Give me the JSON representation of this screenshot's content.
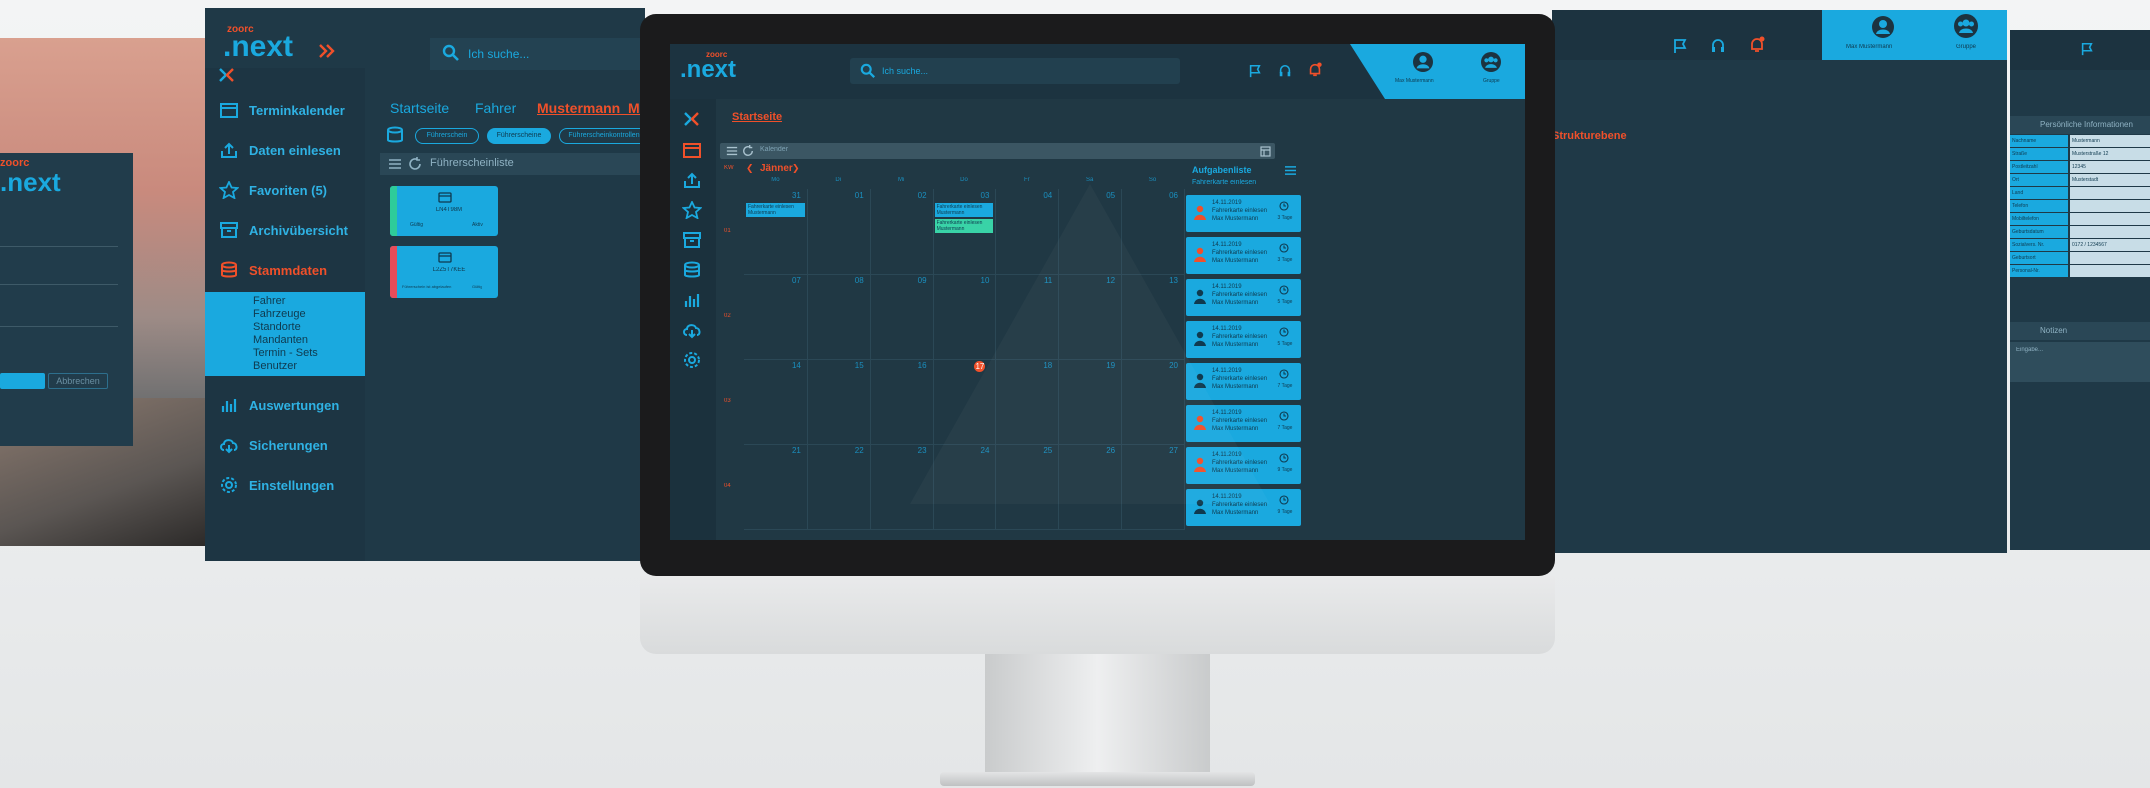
{
  "brand": {
    "small": "zoorc",
    "name": ".next"
  },
  "login": {
    "ok_label": "",
    "cancel_label": "Abbrechen"
  },
  "left_panel": {
    "search_placeholder": "Ich suche...",
    "breadcrumb": [
      "Startseite",
      "Fahrer",
      "Mustermann_Max"
    ],
    "pills": [
      "Führerschein",
      "Führerscheine",
      "Führerscheinkontrollen"
    ],
    "list_title": "Führerscheinliste",
    "cards": [
      {
        "title": "LN4T98M",
        "left": "Gültig",
        "right": "Aktiv",
        "accent": "#2ecc9a"
      },
      {
        "title": "L2Z5T7KEE",
        "left": "Führerschein ist abgelaufen",
        "right": "Gültig",
        "accent": "#e84c5a"
      }
    ],
    "nav": [
      {
        "icon": "calendar-icon",
        "label": "Terminkalender"
      },
      {
        "icon": "upload-icon",
        "label": "Daten einlesen"
      },
      {
        "icon": "star-icon",
        "label": "Favoriten (5)"
      },
      {
        "icon": "archive-icon",
        "label": "Archivübersicht"
      },
      {
        "icon": "database-icon",
        "label": "Stammdaten"
      }
    ],
    "subnav": [
      "Fahrer",
      "Fahrzeuge",
      "Standorte",
      "Mandanten",
      "Termin - Sets",
      "Benutzer"
    ],
    "nav_bottom": [
      {
        "icon": "chart-icon",
        "label": "Auswertungen"
      },
      {
        "icon": "cloud-icon",
        "label": "Sicherungen"
      },
      {
        "icon": "gear-icon",
        "label": "Einstellungen"
      }
    ]
  },
  "main": {
    "search_placeholder": "Ich suche...",
    "breadcrumb": "Startseite",
    "filter_bar_label": "Kalender",
    "month": "Jänner",
    "weekdays": [
      "Mo",
      "Di",
      "Mi",
      "Do",
      "Fr",
      "Sa",
      "So"
    ],
    "week_numbers": [
      "KW",
      "01",
      "02",
      "03",
      "04"
    ],
    "calendar_rows": [
      [
        "31",
        "01",
        "02",
        "03",
        "04",
        "05",
        "06"
      ],
      [
        "07",
        "08",
        "09",
        "10",
        "11",
        "12",
        "13"
      ],
      [
        "14",
        "15",
        "16",
        "17",
        "18",
        "19",
        "20"
      ],
      [
        "21",
        "22",
        "23",
        "24",
        "25",
        "26",
        "27"
      ]
    ],
    "events": [
      {
        "text": "Fahrerkarte einlesen Mustermann",
        "color": "#1aa9df"
      },
      {
        "text": "Fahrerkarte einlesen Mustermann",
        "color": "#1aa9df"
      },
      {
        "text": "Fahrerkarte einlesen Mustermann",
        "color": "#39d3a7"
      }
    ],
    "tasks": {
      "title": "Aufgabenliste",
      "subtitle": "Fahrerkarte einlesen",
      "items": [
        {
          "date": "14.11.2019",
          "line1": "Fahrerkarte einlesen",
          "line2": "Max Mustermann",
          "due": "3 Tage",
          "alert": true
        },
        {
          "date": "14.11.2019",
          "line1": "Fahrerkarte einlesen",
          "line2": "Max Mustermann",
          "due": "3 Tage",
          "alert": true
        },
        {
          "date": "14.11.2019",
          "line1": "Fahrerkarte einlesen",
          "line2": "Max Mustermann",
          "due": "5 Tage",
          "alert": false
        },
        {
          "date": "14.11.2019",
          "line1": "Fahrerkarte einlesen",
          "line2": "Max Mustermann",
          "due": "5 Tage",
          "alert": false
        },
        {
          "date": "14.11.2019",
          "line1": "Fahrerkarte einlesen",
          "line2": "Max Mustermann",
          "due": "7 Tage",
          "alert": false
        },
        {
          "date": "14.11.2019",
          "line1": "Fahrerkarte einlesen",
          "line2": "Max Mustermann",
          "due": "7 Tage",
          "alert": true
        },
        {
          "date": "14.11.2019",
          "line1": "Fahrerkarte einlesen",
          "line2": "Max Mustermann",
          "due": "9 Tage",
          "alert": true
        },
        {
          "date": "14.11.2019",
          "line1": "Fahrerkarte einlesen",
          "line2": "Max Mustermann",
          "due": "9 Tage",
          "alert": false
        }
      ]
    },
    "user": {
      "name": "Max Mustermann",
      "group": "Gruppe"
    }
  },
  "right_panel": {
    "heading": "Strukturebene",
    "user_name": "Max Mustermann",
    "group": "Gruppe"
  },
  "far_right_panel": {
    "table_title": "Persönliche Informationen",
    "rows": [
      {
        "k": "Nachname",
        "v": "Mustermann"
      },
      {
        "k": "Straße",
        "v": "Musterstraße 12"
      },
      {
        "k": "Postleitzahl",
        "v": "12345"
      },
      {
        "k": "Ort",
        "v": "Musterstadt"
      },
      {
        "k": "Land",
        "v": ""
      },
      {
        "k": "Telefon",
        "v": ""
      },
      {
        "k": "Mobiltelefon",
        "v": ""
      },
      {
        "k": "Geburtsdatum",
        "v": ""
      },
      {
        "k": "Sozialvers. Nr.",
        "v": "0172 / 1234567"
      },
      {
        "k": "Geburtsort",
        "v": ""
      },
      {
        "k": "Personal-Nr.",
        "v": ""
      }
    ],
    "section2": "Notizen",
    "placeholder": "Eingabe..."
  },
  "colors": {
    "accent": "#1aa9df",
    "brand_orange": "#f0502a",
    "panel": "#1f3947"
  }
}
